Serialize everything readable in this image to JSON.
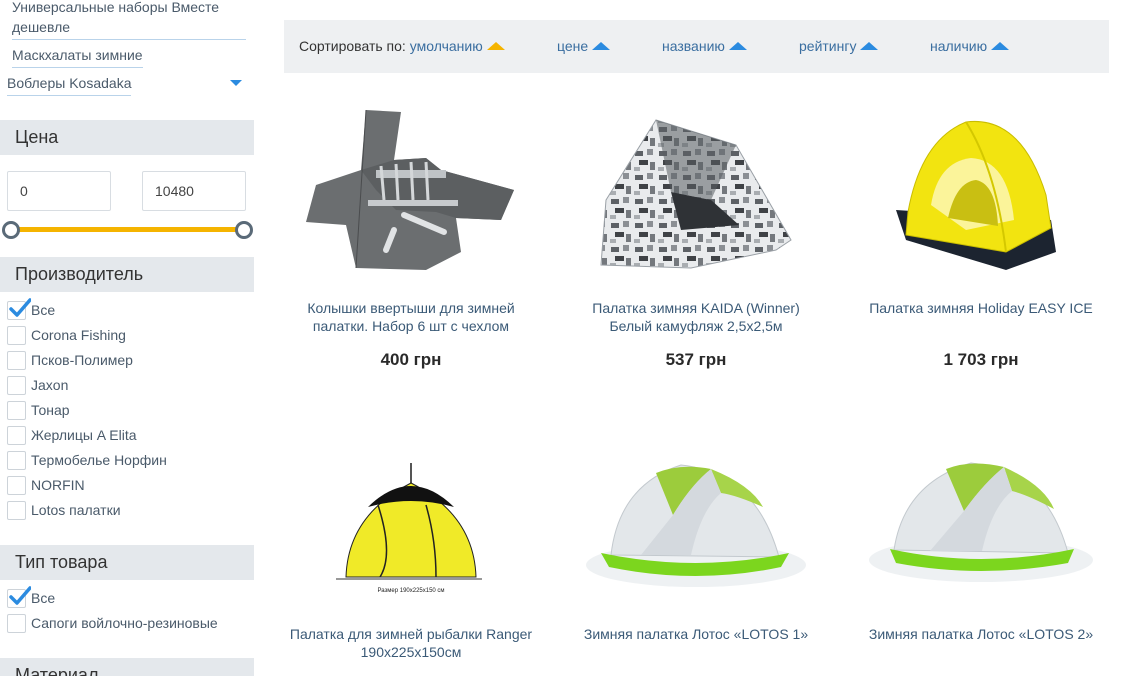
{
  "categories": {
    "link1": "Универсальные наборы Вместе дешевле",
    "link2": "Маскхалаты зимние",
    "select": "Воблеры Kosadaka"
  },
  "price_filter": {
    "title": "Цена",
    "min": "0",
    "max": "10480"
  },
  "manufacturer_filter": {
    "title": "Производитель",
    "options": [
      {
        "label": "Все",
        "checked": true
      },
      {
        "label": "Corona Fishing",
        "checked": false
      },
      {
        "label": "Псков-Полимер",
        "checked": false
      },
      {
        "label": "Jaxon",
        "checked": false
      },
      {
        "label": "Тонар",
        "checked": false
      },
      {
        "label": "Жерлицы A Elita",
        "checked": false
      },
      {
        "label": "Термобелье Норфин",
        "checked": false
      },
      {
        "label": "NORFIN",
        "checked": false
      },
      {
        "label": "Lotos палатки",
        "checked": false
      }
    ]
  },
  "type_filter": {
    "title": "Тип товара",
    "options": [
      {
        "label": "Все",
        "checked": true
      },
      {
        "label": "Сапоги войлочно-резиновые",
        "checked": false
      }
    ]
  },
  "material_filter": {
    "title": "Материал"
  },
  "sort": {
    "prefix": "Сортировать по:",
    "options": [
      {
        "label": "умолчанию",
        "active": true
      },
      {
        "label": "цене",
        "active": false
      },
      {
        "label": "названию",
        "active": false
      },
      {
        "label": "рейтингу",
        "active": false
      },
      {
        "label": "наличию",
        "active": false
      }
    ]
  },
  "products": [
    {
      "name": "Колышки ввертыши для зимней палатки. Набор 6 шт с чехлом",
      "price": "400 грн",
      "image": "tent-pegs-image"
    },
    {
      "name": "Палатка зимняя KAIDA (Winner) Белый камуфляж 2,5х2,5м",
      "price": "537 грн",
      "image": "camo-tent-image"
    },
    {
      "name": "Палатка зимняя Holiday EASY ICE",
      "price": "1 703 грн",
      "image": "yellow-tent-image"
    },
    {
      "name": "Палатка для зимней рыбалки Ranger 190x225x150см",
      "price": "",
      "image": "ranger-tent-image",
      "image_caption": "Размер 190х225х150 см"
    },
    {
      "name": "Зимняя палатка Лотос «LOTOS 1»",
      "price": "",
      "image": "lotos-tent-image"
    },
    {
      "name": "Зимняя палатка Лотос «LOTOS 2»",
      "price": "",
      "image": "lotos-tent-image"
    }
  ],
  "colors": {
    "accent": "#2b8be0",
    "slider": "#f5b400",
    "section_bg": "#e4e8ec",
    "sortbar_bg": "#eef0f2"
  }
}
